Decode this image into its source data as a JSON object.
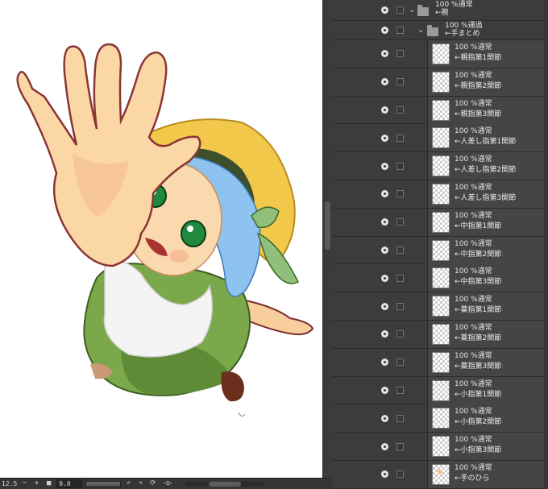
{
  "status_bar": {
    "zoom_value": "12.5",
    "minus_glyph": "−",
    "plus_glyph": "+",
    "rotation_value": "0.0",
    "rotate_left_glyph": "↶",
    "rotate_right_glyph": "↷",
    "reset_glyph": "⟳",
    "flip_glyph": "◁▷"
  },
  "layer_panel": {
    "folders": [
      {
        "opacity_mode": "100 %通常",
        "name": "←腕",
        "expand_glyph": "⌄"
      },
      {
        "opacity_mode": "100 %通過",
        "name": "←手まとめ",
        "expand_glyph": "⌄"
      }
    ],
    "layers": [
      {
        "opacity_mode": "100 %通常",
        "name": "←親指第1関節"
      },
      {
        "opacity_mode": "100 %通常",
        "name": "←親指第2関節"
      },
      {
        "opacity_mode": "100 %通常",
        "name": "←親指第3関節"
      },
      {
        "opacity_mode": "100 %通常",
        "name": "←人差し指第1関節"
      },
      {
        "opacity_mode": "100 %通常",
        "name": "←人差し指第2関節"
      },
      {
        "opacity_mode": "100 %通常",
        "name": "←人差し指第3関節"
      },
      {
        "opacity_mode": "100 %通常",
        "name": "←中指第1関節"
      },
      {
        "opacity_mode": "100 %通常",
        "name": "←中指第2関節"
      },
      {
        "opacity_mode": "100 %通常",
        "name": "←中指第3関節"
      },
      {
        "opacity_mode": "100 %通常",
        "name": "←薬指第1関節"
      },
      {
        "opacity_mode": "100 %通常",
        "name": "←薬指第2関節"
      },
      {
        "opacity_mode": "100 %通常",
        "name": "←薬指第3関節"
      },
      {
        "opacity_mode": "100 %通常",
        "name": "←小指第1関節"
      },
      {
        "opacity_mode": "100 %通常",
        "name": "←小指第2関節"
      },
      {
        "opacity_mode": "100 %通常",
        "name": "←小指第3関節"
      },
      {
        "opacity_mode": "100 %通常",
        "name": "←手のひら"
      }
    ]
  },
  "colors": {
    "panel_bg": "#3c3c3c",
    "canvas_paper": "#ffffff",
    "hair": "#8ec3f0",
    "hat": "#f2c84b",
    "dress": "#7aa84a",
    "skin": "#f9d9ad"
  }
}
